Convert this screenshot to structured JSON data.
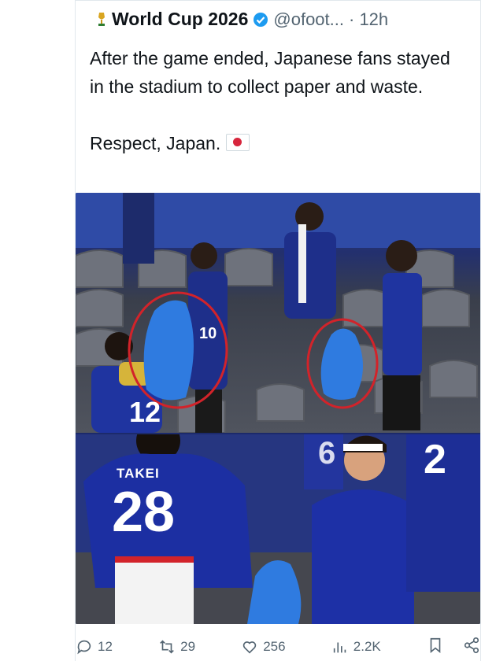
{
  "tweet": {
    "author_name": "World Cup 2026",
    "handle": "@ofoot...",
    "time": "· 12h",
    "text": "After the game ended, Japanese fans stayed in the stadium to collect paper and waste.\n\nRespect, Japan."
  },
  "media": {
    "top_jersey_text": "10",
    "top_left_jersey_number": "12",
    "bottom_jersey_name": "TAKEI",
    "bottom_jersey_number": "28",
    "bottom_right_number": "2",
    "bottom_right_number_2": "6"
  },
  "actions": {
    "replies": "12",
    "reposts": "29",
    "likes": "256",
    "views": "2.2K"
  },
  "colors": {
    "accent": "#1d9bf0",
    "verified": "#1d9bf0",
    "circle": "#d2232a"
  }
}
